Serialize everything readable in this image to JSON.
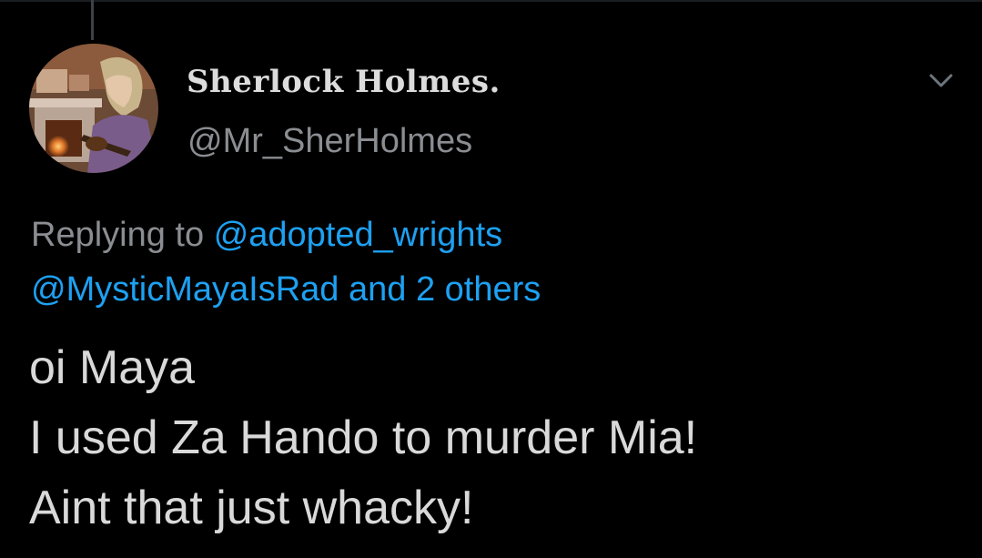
{
  "tweet": {
    "display_name": "Sherlock Holmes.",
    "handle": "@Mr_SherHolmes",
    "replying_prefix": "Replying to",
    "reply_mention_1": "@adopted_wrights",
    "reply_mention_2": "@MysticMayaIsRad",
    "reply_connector": "and",
    "reply_others": "2 others",
    "text_lines": [
      "oi Maya",
      "I used Za Hando to murder Mia!",
      "Aint that just whacky!"
    ]
  },
  "colors": {
    "background": "#000000",
    "link": "#1da1f2",
    "secondary_text": "#8a8d91",
    "primary_text": "#d9d9d9"
  },
  "icons": {
    "menu": "chevron-down-icon"
  }
}
